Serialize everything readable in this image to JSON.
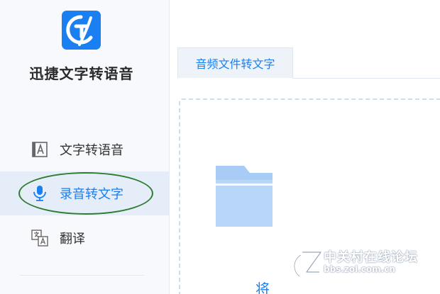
{
  "app": {
    "name": "迅捷文字转语音",
    "accent_color": "#1a7ff0"
  },
  "sidebar": {
    "items": [
      {
        "label": "文字转语音",
        "icon": "text-to-speech-icon",
        "active": false
      },
      {
        "label": "录音转文字",
        "icon": "microphone-icon",
        "active": true
      },
      {
        "label": "翻译",
        "icon": "translate-icon",
        "active": false
      }
    ]
  },
  "main": {
    "tabs": [
      {
        "label": "音频文件转文字",
        "active": true
      }
    ],
    "drop_zone": {
      "icon": "folder-icon",
      "hint": "将"
    }
  },
  "watermark": {
    "title": "中关村在线论坛",
    "url": "bbs.zol.com.cn"
  }
}
